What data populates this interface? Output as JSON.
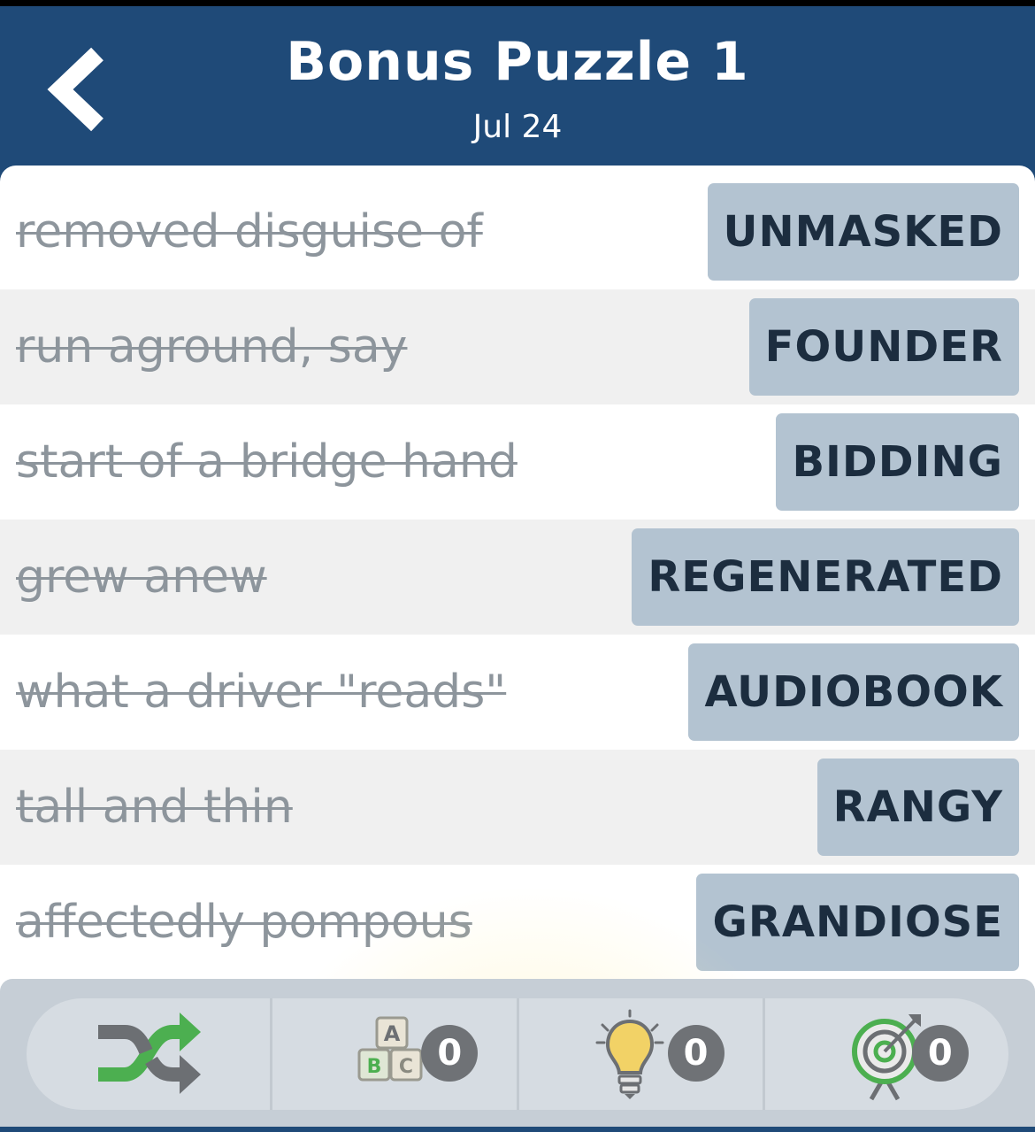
{
  "header": {
    "title": "Bonus Puzzle 1",
    "date": "Jul 24",
    "back_icon": "chevron-left-icon"
  },
  "clues": [
    {
      "clue": "removed disguise of",
      "answer": "UNMASKED"
    },
    {
      "clue": "run aground, say",
      "answer": "FOUNDER"
    },
    {
      "clue": "start of a bridge hand",
      "answer": "BIDDING"
    },
    {
      "clue": "grew anew",
      "answer": "REGENERATED"
    },
    {
      "clue": "what a driver \"reads\"",
      "answer": "AUDIOBOOK"
    },
    {
      "clue": "tall and thin",
      "answer": "RANGY"
    },
    {
      "clue": "affectedly pompous",
      "answer": "GRANDIOSE"
    }
  ],
  "toolbar": {
    "shuffle_icon": "shuffle-icon",
    "letters_icon": "abc-blocks-icon",
    "letters_count": "0",
    "hint_icon": "lightbulb-icon",
    "hint_count": "0",
    "target_icon": "target-icon",
    "target_count": "0"
  },
  "colors": {
    "header_bg": "#1f4a78",
    "answer_bg": "#b3c3d1",
    "answer_text": "#1c2d3f",
    "clue_text": "#8d959c",
    "alt_row": "#f0f0f0"
  }
}
